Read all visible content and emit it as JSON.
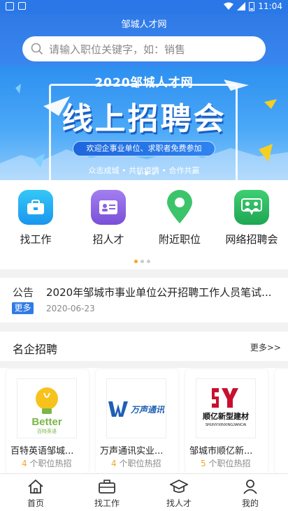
{
  "status_bar": {
    "time": "11:04",
    "battery": "8",
    "icons": [
      "notification-square-icon",
      "image-icon",
      "wifi-icon",
      "signal-icon",
      "battery-icon"
    ]
  },
  "app": {
    "title": "邹城人才网"
  },
  "search": {
    "placeholder": "请输入职位关键字，如：销售"
  },
  "banner": {
    "year_title": "2020邹城人才网",
    "headline": "线上招聘会",
    "pill": "欢迎企事业单位、求职者免费参加",
    "slogan": "众志成城 • 共抗疫情 • 合作共赢",
    "slide_count": 3,
    "active_slide": 1
  },
  "quick_menu": {
    "items": [
      {
        "label": "找工作",
        "icon": "briefcase-icon",
        "color": "#1ea7f2"
      },
      {
        "label": "招人才",
        "icon": "id-card-icon",
        "color": "#8a63e0"
      },
      {
        "label": "附近职位",
        "icon": "location-pin-icon",
        "color": "#3cc46a"
      },
      {
        "label": "网络招聘会",
        "icon": "people-chat-icon",
        "color": "#25b35a"
      }
    ],
    "page_count": 3,
    "active_page": 0
  },
  "notice": {
    "label_top": "公告",
    "label_badge": "更多",
    "headline": "2020年邹城市事业单位公开招聘工作人员笔试...",
    "date": "2020-06-23"
  },
  "famous": {
    "title": "名企招聘",
    "more": "更多>>",
    "cards": [
      {
        "name": "百特英语邹城...",
        "count": "4",
        "suffix": "个职位热招",
        "logo": {
          "type": "bulb",
          "brand": "Better",
          "sub": "百特英语"
        }
      },
      {
        "name": "万声通讯实业...",
        "count": "4",
        "suffix": "个职位热招",
        "logo": {
          "type": "wanshen",
          "brand": "万声通讯"
        }
      },
      {
        "name": "邹城市顺亿新...",
        "count": "5",
        "suffix": "个职位热招",
        "logo": {
          "type": "sy",
          "brand": "顺亿新型建材",
          "sub": "SHUNYIXINXINGJIANCAI"
        }
      }
    ]
  },
  "tabbar": {
    "items": [
      {
        "label": "首页",
        "icon": "home-icon"
      },
      {
        "label": "找工作",
        "icon": "briefcase-icon"
      },
      {
        "label": "找人才",
        "icon": "graduation-cap-icon"
      },
      {
        "label": "我的",
        "icon": "user-icon"
      }
    ]
  },
  "colors": {
    "primary": "#2f7ae6",
    "accent": "#f5a623"
  }
}
